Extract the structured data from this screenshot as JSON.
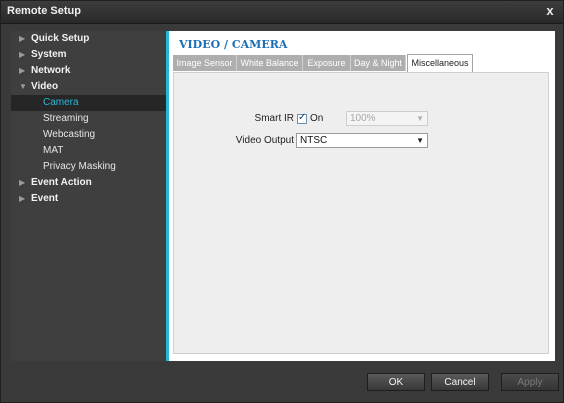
{
  "window": {
    "title": "Remote Setup",
    "close_glyph": "x"
  },
  "sidebar": {
    "items": [
      {
        "label": "Quick Setup",
        "icon": "triangle-right-icon"
      },
      {
        "label": "System",
        "icon": "triangle-right-icon"
      },
      {
        "label": "Network",
        "icon": "triangle-right-icon"
      },
      {
        "label": "Video",
        "icon": "triangle-down-icon"
      },
      {
        "label": "Camera",
        "selected": true
      },
      {
        "label": "Streaming"
      },
      {
        "label": "Webcasting"
      },
      {
        "label": "MAT"
      },
      {
        "label": "Privacy Masking"
      },
      {
        "label": "Event Action",
        "icon": "triangle-right-icon"
      },
      {
        "label": "Event",
        "icon": "triangle-right-icon"
      }
    ]
  },
  "main": {
    "title": "VIDEO / CAMERA",
    "tabs": [
      {
        "label": "Image Sensor"
      },
      {
        "label": "White Balance"
      },
      {
        "label": "Exposure"
      },
      {
        "label": "Day & Night"
      },
      {
        "label": "Miscellaneous",
        "active": true
      }
    ],
    "smart_ir": {
      "label": "Smart IR",
      "checkbox_label": "On",
      "checked": true,
      "value": "100%"
    },
    "video_output": {
      "label": "Video Output",
      "value": "NTSC"
    }
  },
  "footer": {
    "ok_label": "OK",
    "cancel_label": "Cancel",
    "apply_label": "Apply"
  },
  "colors": {
    "accent": "#25b6d8",
    "title_blue": "#1b6fb4"
  }
}
